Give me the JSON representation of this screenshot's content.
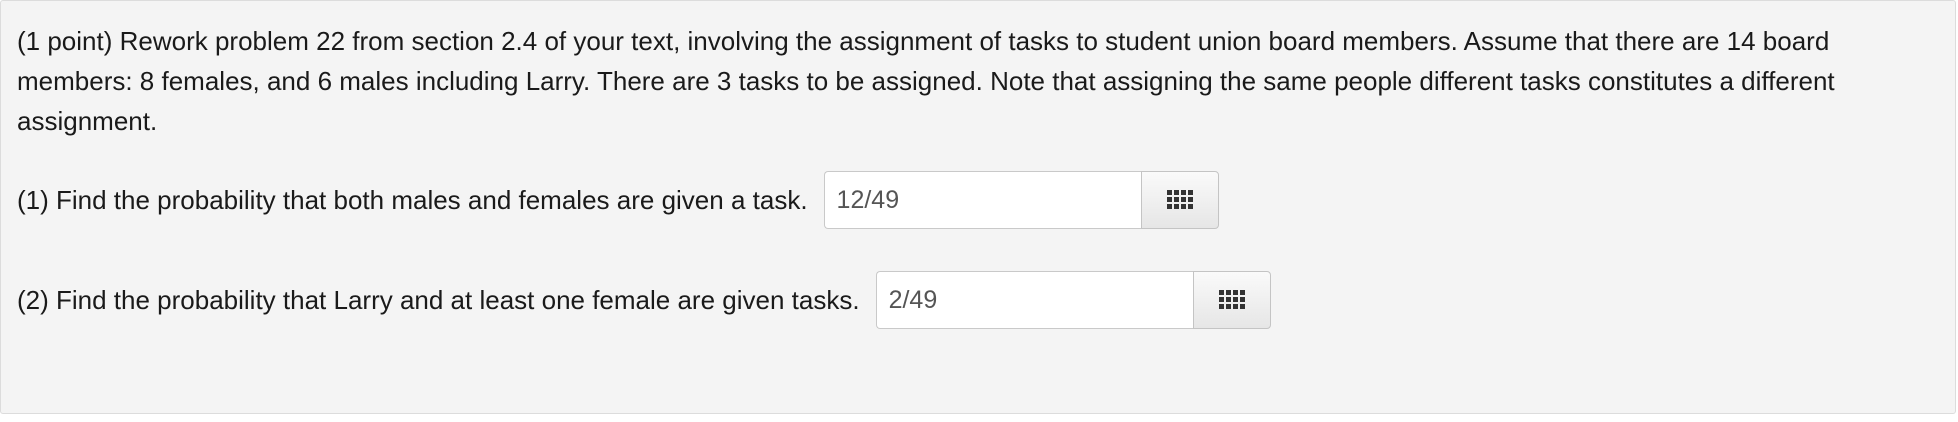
{
  "problem": {
    "statement": "(1 point) Rework problem 22 from section 2.4 of your text, involving the assignment of tasks to student union board members. Assume that there are 14 board members: 8 females, and 6 males including Larry. There are 3 tasks to be assigned. Note that assigning the same people different tasks constitutes a different assignment.",
    "questions": [
      {
        "text": "(1) Find the probability that both males and females are given a task.",
        "answer": "12/49",
        "button_icon": "equation-palette-icon"
      },
      {
        "text": "(2) Find the probability that Larry and at least one female are given tasks.",
        "answer": "2/49",
        "button_icon": "equation-palette-icon"
      }
    ]
  }
}
